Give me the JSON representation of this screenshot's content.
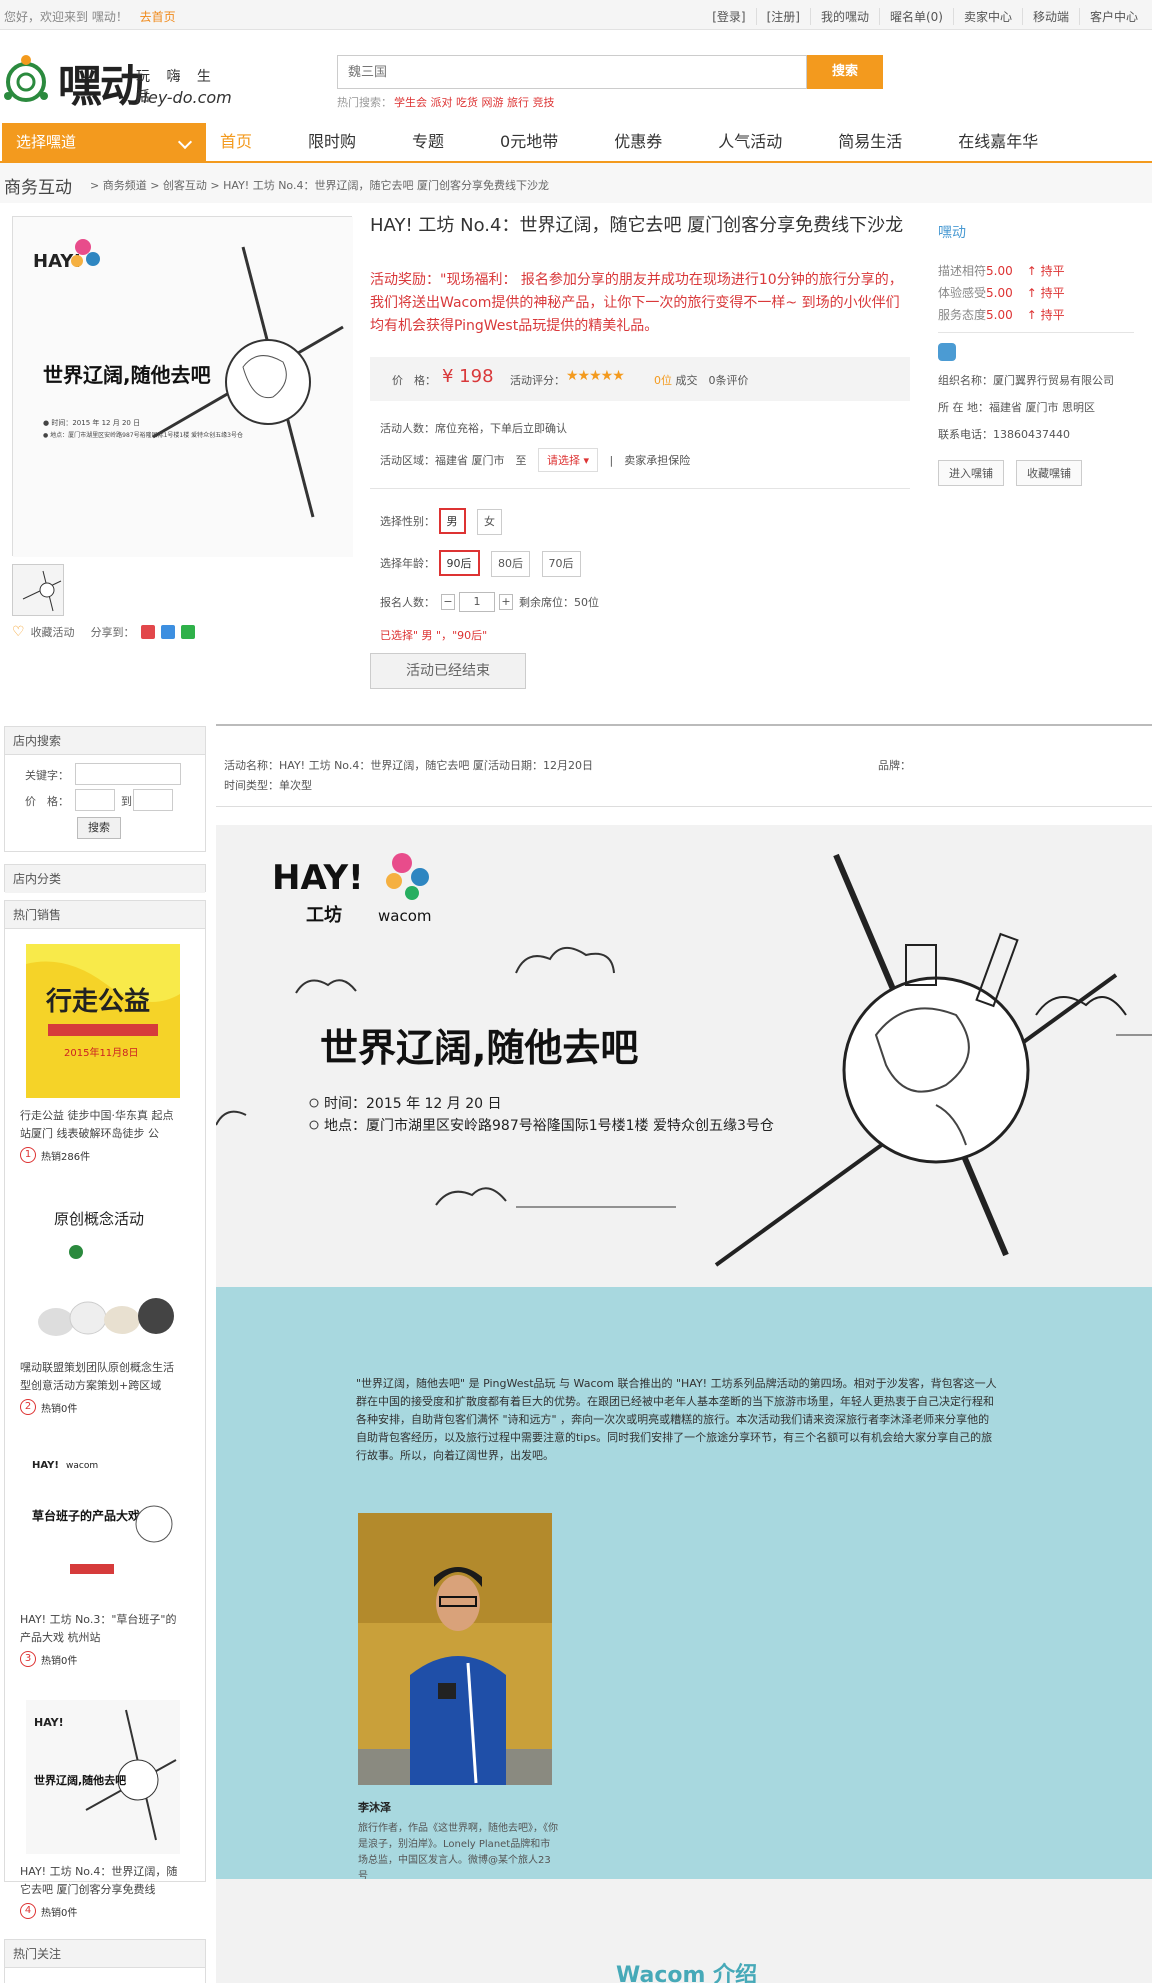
{
  "topbar": {
    "welcome": "您好，欢迎来到 嘿动！",
    "home_link": "去首页",
    "links": [
      "[登录]",
      "[注册]",
      "我的嘿动",
      "曜名单(0)",
      "卖家中心",
      "移动端",
      "客户中心"
    ]
  },
  "header": {
    "logo_cn": "嘿动",
    "logo_sub": "玩 嗨 生 活",
    "logo_en": "Hey-do.com",
    "search_placeholder": "魏三国",
    "search_button": "搜索",
    "hot_label": "热门搜索：",
    "hot_keywords": "学生会 派对 吃货 网游 旅行 竞技"
  },
  "nav": {
    "category_label": "选择嘿道",
    "items": [
      "首页",
      "限时购",
      "专题",
      "0元地带",
      "优惠券",
      "人气活动",
      "简易生活",
      "在线嘉年华"
    ]
  },
  "breadcrumb": {
    "root": "商务互动",
    "path": "> 商务频道 > 创客互动 > HAY! 工坊 No.4：世界辽阔，随它去吧 厦门创客分享免费线下沙龙"
  },
  "product": {
    "image_title": "世界辽阔,随他去吧",
    "image_date": "● 时间：2015 年 12 月 20 日",
    "image_addr": "● 地点：厦门市湖里区安岭路987号裕隆国际1号楼1楼 爱特众创五缘3号仓",
    "title": "HAY! 工坊 No.4：世界辽阔，随它去吧 厦门创客分享免费线下沙龙",
    "desc": "活动奖励：\"现场福利： 报名参加分享的朋友并成功在现场进行10分钟的旅行分享的，我们将送出Wacom提供的神秘产品，让你下一次的旅行变得不一样~ 到场的小伙伴们均有机会获得PingWest品玩提供的精美礼品。",
    "price_label": "价　格：",
    "price": "¥ 198",
    "rating_label": "活动评分：",
    "stars": "★★★★★",
    "deal_count": "0位",
    "deal_label": "成交",
    "review": "0条评价",
    "people_label": "活动人数：",
    "people_value": "席位充裕，下单后立即确认",
    "region_label": "活动区域：",
    "region_value": "福建省 厦门市　至",
    "region_select": "请选择 ▾",
    "region_note": "|　卖家承担保险",
    "gender_label": "选择性别：",
    "genders": [
      "男",
      "女"
    ],
    "age_label": "选择年龄：",
    "ages": [
      "90后",
      "80后",
      "70后"
    ],
    "signup_label": "报名人数：",
    "qty_minus": "−",
    "qty_value": "1",
    "qty_plus": "+",
    "remaining": "剩余席位：50位",
    "chosen": "已选择\" 男 \"，\"90后\"",
    "ended_button": "活动已经结束",
    "favorite": "收藏活动",
    "share_label": "分享到："
  },
  "seller": {
    "name": "嘿动",
    "scores": [
      {
        "label": "描述相符",
        "value": "5.00",
        "trend": "持平"
      },
      {
        "label": "体验感受",
        "value": "5.00",
        "trend": "持平"
      },
      {
        "label": "服务态度",
        "value": "5.00",
        "trend": "持平"
      }
    ],
    "org": "组织名称：厦门翼界行贸易有限公司",
    "location": "所 在 地：福建省 厦门市 思明区",
    "phone": "联系电话：13860437440",
    "enter_button": "进入嘿铺",
    "fav_button": "收藏嘿铺"
  },
  "sidebar": {
    "search_title": "店内搜索",
    "keyword_label": "关键字：",
    "price_label": "价　格：",
    "to_label": "到",
    "search_button": "搜索",
    "category_title": "店内分类",
    "hot_title": "热门销售",
    "hot_items": [
      {
        "rank": "1",
        "title": "行走公益 徒步中国·华东真 起点站厦门 线表破解环岛徒步 公",
        "sold": "热销286件",
        "pic_text": "行走公益"
      },
      {
        "rank": "2",
        "title": "嘿动联盟策划团队原创概念生活型创意活动方案策划+跨区域",
        "sold": "热销0件",
        "pic_text": "原创概念活动"
      },
      {
        "rank": "3",
        "title": "HAY! 工坊 No.3：\"草台班子\"的产品大戏 杭州站",
        "sold": "热销0件",
        "pic_text": "草台班子的产品大戏"
      },
      {
        "rank": "4",
        "title": "HAY! 工坊 No.4：世界辽阔，随它去吧 厦门创客分享免费线",
        "sold": "热销0件",
        "pic_text": "世界辽阔,随他去吧"
      }
    ],
    "follow_title": "热门关注"
  },
  "detail": {
    "meta_name": "活动名称：HAY! 工坊 No.4：世界辽阔，随它去吧 厦门创...",
    "meta_date": "活动日期：12月20日",
    "meta_brand": "品牌：",
    "meta_type": "时间类型：单次型",
    "banner_title": "世界辽阔,随他去吧",
    "banner_time": "时间：2015 年 12 月 20 日",
    "banner_addr": "地点：厦门市湖里区安岭路987号裕隆国际1号楼1楼 爱特众创五缘3号仓",
    "banner_hay": "HAY!",
    "banner_workshop": "工坊",
    "banner_wacom": "wacom",
    "intro": "\"世界辽阔，随他去吧\" 是 PingWest品玩 与 Wacom 联合推出的 \"HAY! 工坊系列品牌活动的第四场。相对于沙发客，背包客这一人群在中国的接受度和扩散度都有着巨大的优势。在跟团已经被中老年人基本垄断的当下旅游市场里，年轻人更热衷于自己决定行程和各种安排，自助背包客们满怀 \"诗和远方\" ，奔向一次次或明亮或糟糕的旅行。本次活动我们请来资深旅行者李沐泽老师来分享他的自助背包客经历，以及旅行过程中需要注意的tips。同时我们安排了一个旅途分享环节，有三个名额可以有机会给大家分享自己的旅行故事。所以，向着辽阔世界，出发吧。",
    "speaker_name": "李沐泽",
    "speaker_bio": "旅行作者，作品《这世界啊，随他去吧》，《你是浪子，别泊岸》。Lonely Planet品牌和市场总监，中国区发言人。微博@某个旅人23号",
    "wacom_heading": "Wacom 介绍"
  }
}
